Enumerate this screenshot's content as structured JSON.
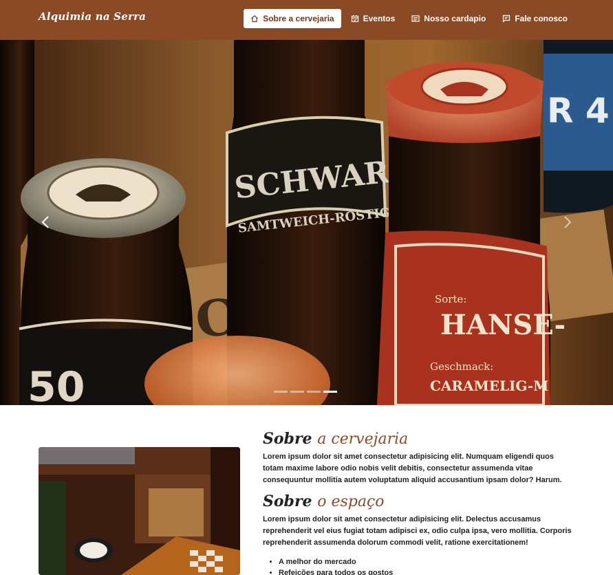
{
  "navbar": {
    "brand": "Alquimia na Serra",
    "items": [
      {
        "label": "Sobre a cervejaria",
        "icon": "home-icon",
        "active": true
      },
      {
        "label": "Eventos",
        "icon": "calendar-icon",
        "active": false
      },
      {
        "label": "Nosso cardapio",
        "icon": "menu-icon",
        "active": false
      },
      {
        "label": "Fale conosco",
        "icon": "chat-icon",
        "active": false
      }
    ]
  },
  "hero": {
    "labels": {
      "schwarz": "SCHWARZ-B",
      "samt": "SAMTWEICH-RÖSTIG",
      "chat": "CHAT",
      "sorte": "Sorte:",
      "hanse": "HANSE-",
      "geschmack": "Geschmack:",
      "caramel": "CARAMELIG-M",
      "alc": "50",
      "blue": "R 4"
    },
    "slides": 4,
    "active_slide": 3
  },
  "about": {
    "title_main": "Sobre",
    "title_accent": "a cervejaria",
    "text": "Lorem ipsum dolor sit amet consectetur adipisicing elit. Numquam eligendi quos totam maxime labore odio nobis velit debitis, consectetur assumenda vitae consequuntur mollitia autem voluptatum aliquid accusantium ipsam dolor? Harum."
  },
  "space": {
    "title_main": "Sobre",
    "title_accent": "o espaço",
    "text": "Lorem ipsum dolor sit amet consectetur adipisicing elit. Delectus accusamus reprehenderit vel eius fugiat totam adipisci ex, odio culpa ipsa, vero mollitia. Corporis reprehenderit assumenda dolorum commodi velit, ratione exercitationem!",
    "bullets": [
      "A melhor do mercado",
      "Refeições para todos os gostos"
    ]
  },
  "colors": {
    "navbar": "#8a4a26",
    "accent": "#8a4a26"
  }
}
